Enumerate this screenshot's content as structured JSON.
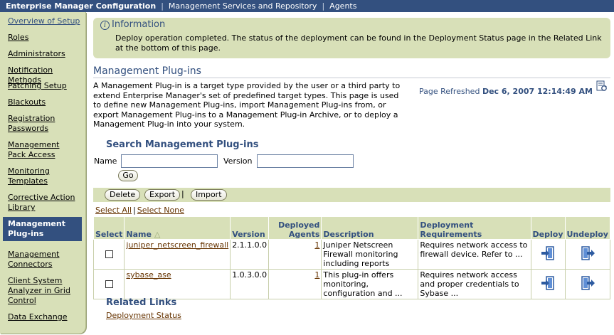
{
  "topbar": {
    "app_title": "Enterprise Manager Configuration",
    "links": [
      "Management Services and Repository",
      "Agents"
    ]
  },
  "sidebar": {
    "items": [
      {
        "label": "Overview of Setup"
      },
      {
        "label": "Roles"
      },
      {
        "label": "Administrators"
      },
      {
        "label": "Notification Methods"
      },
      {
        "label": "Patching Setup"
      },
      {
        "label": "Blackouts"
      },
      {
        "label": "Registration Passwords"
      },
      {
        "label": "Management Pack Access"
      },
      {
        "label": "Monitoring Templates"
      },
      {
        "label": "Corrective Action Library"
      },
      {
        "label": "Management Plug-ins",
        "active": true
      },
      {
        "label": "Management Connectors"
      },
      {
        "label": "Client System Analyzer in Grid Control"
      },
      {
        "label": "Data Exchange"
      }
    ]
  },
  "info": {
    "heading": "Information",
    "message": "Deploy operation completed. The status of the deployment can be found in the Deployment Status page in the Related Link at the bottom of this page."
  },
  "page": {
    "title": "Management Plug-ins",
    "description": "A Management Plug-in is a target type provided by the user or a third party to extend Enterprise Manager's set of predefined target types. This page is used to define new Management Plug-ins, import Management Plug-ins from, or export Management Plug-ins to a Management Plug-in Archive, or to deploy a Management Plug-in into your system.",
    "refresh_label": "Page Refreshed",
    "refresh_time": "Dec 6, 2007 12:14:49 AM"
  },
  "search": {
    "title": "Search Management Plug-ins",
    "name_label": "Name",
    "name_value": "",
    "version_label": "Version",
    "version_value": "",
    "go_label": "Go"
  },
  "actions": {
    "delete": "Delete",
    "export": "Export",
    "import": "Import",
    "select_all": "Select All",
    "select_none": "Select None"
  },
  "table": {
    "headers": {
      "select": "Select",
      "name": "Name",
      "version": "Version",
      "deployed_agents": "Deployed Agents",
      "description": "Description",
      "requirements": "Deployment Requirements",
      "deploy": "Deploy",
      "undeploy": "Undeploy"
    },
    "rows": [
      {
        "name": "juniper_netscreen_firewall",
        "version": "2.1.1.0.0",
        "agents": "1",
        "description": "Juniper Netscreen Firewall monitoring including reports",
        "requirements": "Requires network access to firewall device. Refer to ..."
      },
      {
        "name": "sybase_ase",
        "version": "1.0.3.0.0",
        "agents": "1",
        "description": "This plug-in offers monitoring, configuration and ...",
        "requirements": "Requires network access and proper credentials to Sybase ..."
      }
    ]
  },
  "related": {
    "title": "Related Links",
    "link": "Deployment Status"
  },
  "colors": {
    "brand_blue": "#33507f",
    "panel_green": "#d8e0b8",
    "link_brown": "#663300"
  },
  "icons": [
    "info-icon",
    "sort-ascending-icon",
    "refresh-icon",
    "deploy-icon",
    "undeploy-icon"
  ]
}
